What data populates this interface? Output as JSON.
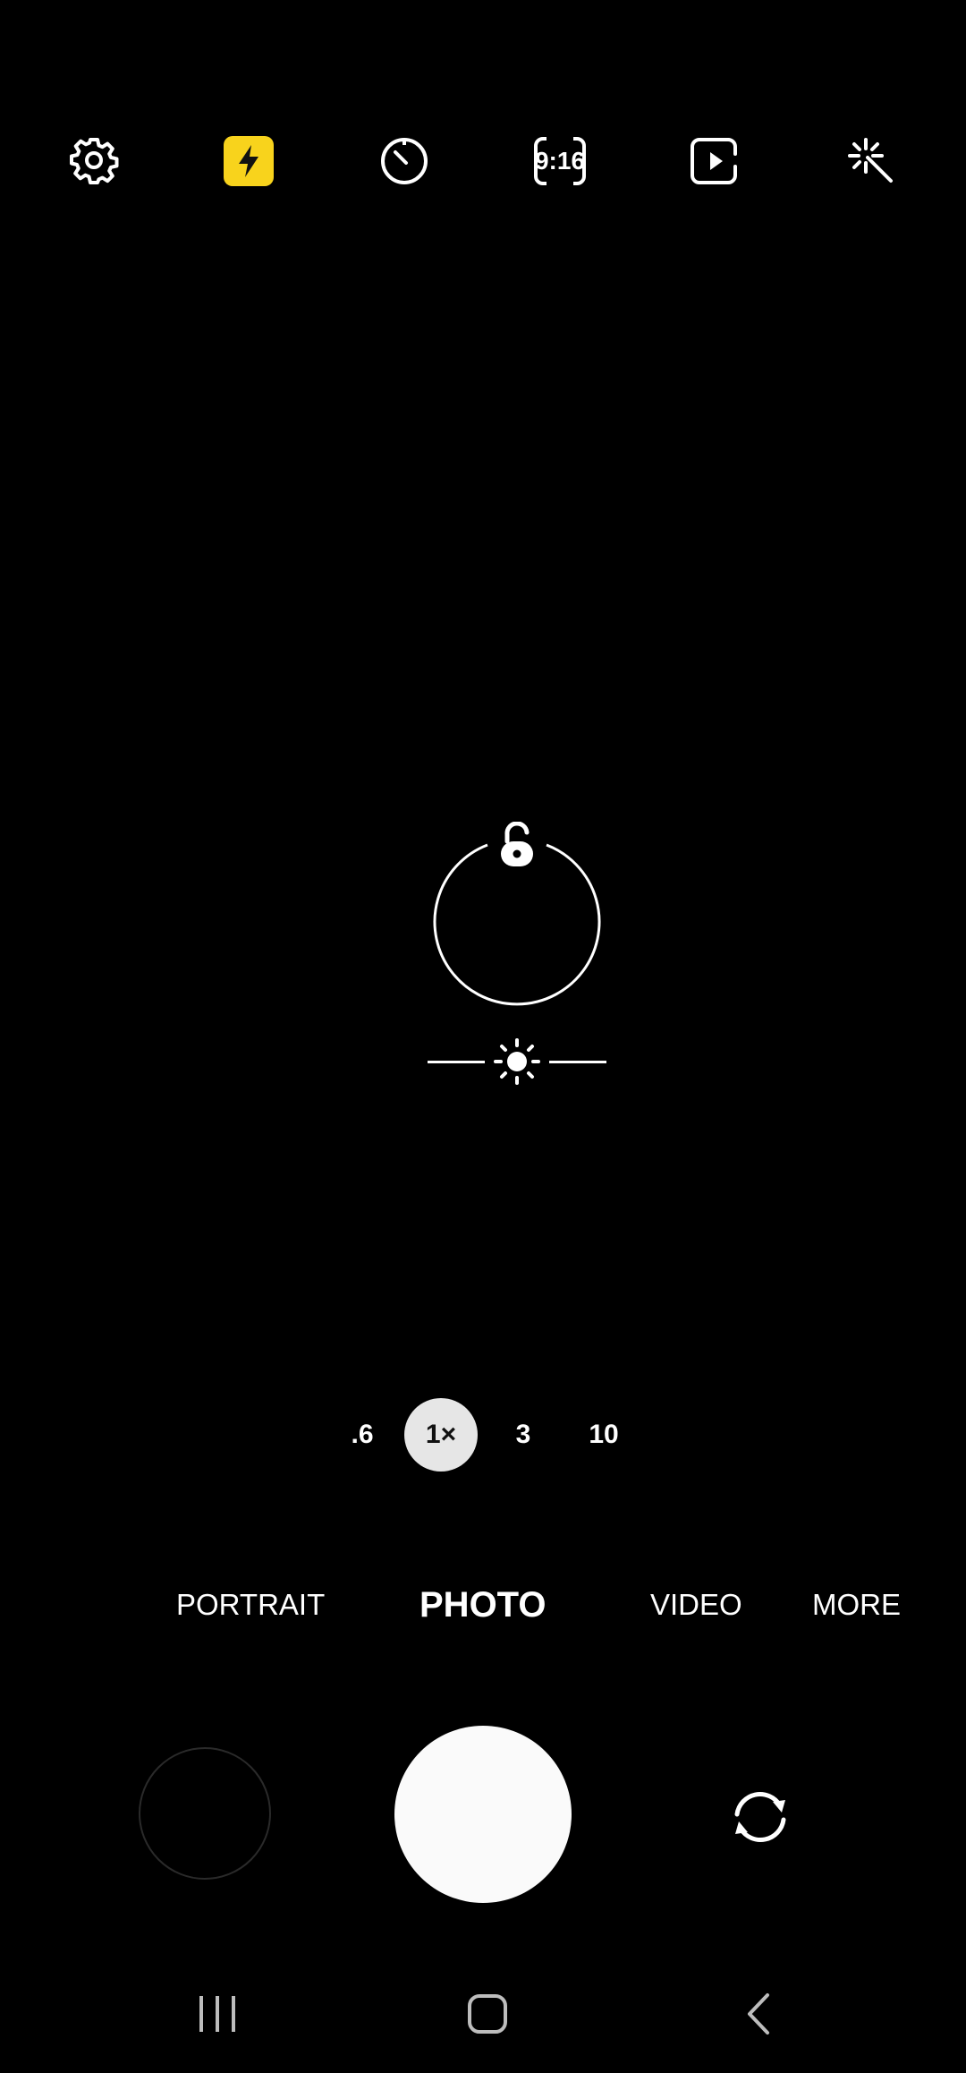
{
  "toolbar": {
    "settings_icon": "gear-icon",
    "flash_icon": "flash-icon",
    "timer_icon": "timer-icon",
    "aspect_ratio": "9:16",
    "motion_photo_icon": "motion-photo-icon",
    "filters_icon": "magic-wand-icon",
    "flash_color": "#F8D31C"
  },
  "focus": {
    "lock_icon": "unlock-icon",
    "exposure_icon": "brightness-icon"
  },
  "zoom": {
    "levels": [
      ".6",
      "1×",
      "3",
      "10"
    ],
    "selected": "1×"
  },
  "modes": {
    "items": [
      "PORTRAIT",
      "PHOTO",
      "VIDEO",
      "MORE"
    ],
    "selected": "PHOTO"
  },
  "controls": {
    "gallery": "gallery-thumbnail",
    "shutter": "shutter-button",
    "switch_camera_icon": "switch-camera-icon"
  },
  "navbar": {
    "recents_icon": "recents-icon",
    "home_icon": "home-icon",
    "back_icon": "back-icon"
  }
}
